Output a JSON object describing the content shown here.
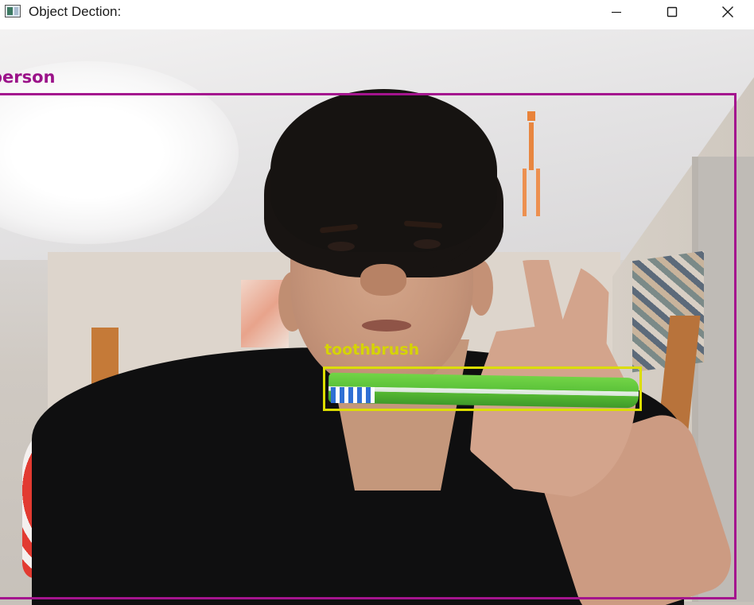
{
  "window": {
    "title": "Object Dection:",
    "icon": "app-window-icon",
    "controls": {
      "minimize": "minimize-icon",
      "maximize": "maximize-icon",
      "close": "close-icon"
    }
  },
  "detections": [
    {
      "label": "person",
      "color": "#a4148e"
    },
    {
      "label": "toothbrush",
      "color": "#dcdd00"
    }
  ],
  "colors": {
    "person_box": "#a4148e",
    "toothbrush_box": "#dcdd00",
    "titlebar_bg": "#ffffff"
  }
}
